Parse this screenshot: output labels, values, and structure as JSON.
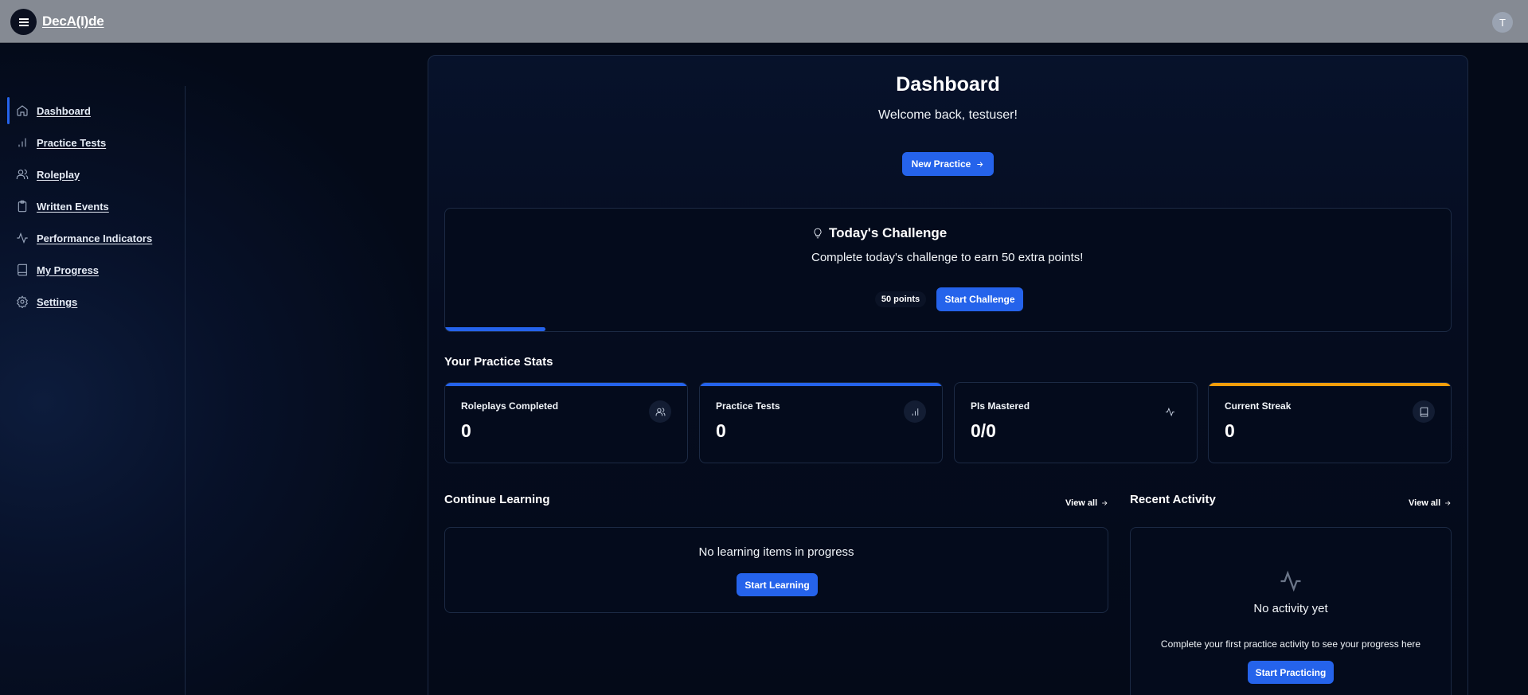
{
  "app": {
    "brand": "DecA(I)de",
    "avatar_initial": "T"
  },
  "sidebar": {
    "items": [
      {
        "label": "Dashboard",
        "icon": "home-icon",
        "active": true
      },
      {
        "label": "Practice Tests",
        "icon": "bar-chart-icon",
        "active": false
      },
      {
        "label": "Roleplay",
        "icon": "users-icon",
        "active": false
      },
      {
        "label": "Written Events",
        "icon": "clipboard-icon",
        "active": false
      },
      {
        "label": "Performance Indicators",
        "icon": "activity-icon",
        "active": false
      },
      {
        "label": "My Progress",
        "icon": "book-icon",
        "active": false
      },
      {
        "label": "Settings",
        "icon": "gear-icon",
        "active": false
      }
    ]
  },
  "dashboard": {
    "title": "Dashboard",
    "welcome": "Welcome back, testuser!",
    "new_practice_label": "New Practice"
  },
  "challenge": {
    "title": "Today's Challenge",
    "description": "Complete today's challenge to earn 50 extra points!",
    "points_label": "50 points",
    "start_label": "Start Challenge",
    "progress": 0.1
  },
  "stats": {
    "section_title": "Your Practice Stats",
    "cards": [
      {
        "label": "Roleplays Completed",
        "value": "0",
        "icon": "users-icon",
        "accent": "#2563eb"
      },
      {
        "label": "Practice Tests",
        "value": "0",
        "icon": "bar-chart-icon",
        "accent": "#2563eb"
      },
      {
        "label": "PIs Mastered",
        "value": "0/0",
        "icon": "activity-icon",
        "accent": ""
      },
      {
        "label": "Current Streak",
        "value": "0",
        "icon": "book-icon",
        "accent": "#f59e0b"
      }
    ]
  },
  "continue_learning": {
    "title": "Continue Learning",
    "view_all": "View all",
    "empty_text": "No learning items in progress",
    "button_label": "Start Learning"
  },
  "recent_activity": {
    "title": "Recent Activity",
    "view_all": "View all",
    "empty_title": "No activity yet",
    "empty_desc": "Complete your first practice activity to see your progress here",
    "button_label": "Start Practicing"
  },
  "colors": {
    "accent": "#2563eb",
    "streak": "#f59e0b",
    "background": "#040a18"
  }
}
